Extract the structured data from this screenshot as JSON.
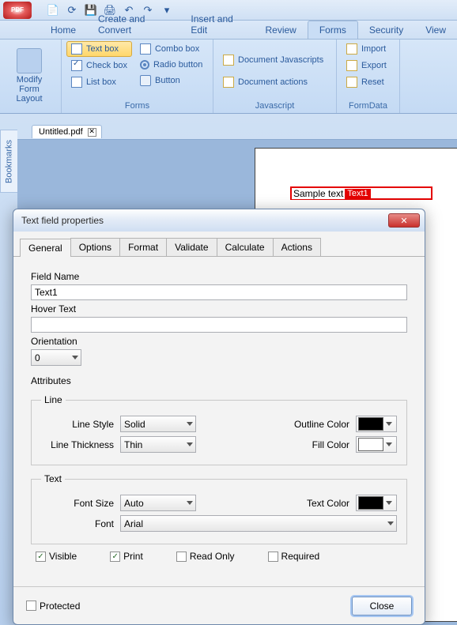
{
  "app": {
    "orb": "PDF"
  },
  "qat": {
    "tips": [
      "pdf-doc",
      "refresh",
      "save",
      "print",
      "undo",
      "redo",
      "more"
    ]
  },
  "tabs": [
    "Home",
    "Create and Convert",
    "Insert and Edit",
    "Review",
    "Forms",
    "Security",
    "View"
  ],
  "active_tab": 4,
  "ribbon": {
    "group1": {
      "title": "",
      "modify": "Modify Form Layout"
    },
    "group2": {
      "title": "Forms",
      "col1": [
        "Text box",
        "Check box",
        "List box"
      ],
      "col2": [
        "Combo box",
        "Radio button",
        "Button"
      ]
    },
    "group3": {
      "title": "Javascript",
      "items": [
        "Document Javascripts",
        "Document actions"
      ]
    },
    "group4": {
      "title": "FormData",
      "items": [
        "Import",
        "Export",
        "Reset"
      ]
    }
  },
  "sidetab": "Bookmarks",
  "filetab": {
    "name": "Untitled.pdf"
  },
  "canvas": {
    "sample_text": "Sample text",
    "field_tag": "Text1"
  },
  "dialog": {
    "title": "Text field properties",
    "tabs": [
      "General",
      "Options",
      "Format",
      "Validate",
      "Calculate",
      "Actions"
    ],
    "active_tab": 0,
    "general": {
      "field_name_label": "Field Name",
      "field_name": "Text1",
      "hover_text_label": "Hover Text",
      "hover_text": "",
      "orientation_label": "Orientation",
      "orientation": "0",
      "attributes_label": "Attributes",
      "line": {
        "legend": "Line",
        "style_label": "Line Style",
        "style": "Solid",
        "thickness_label": "Line Thickness",
        "thickness": "Thin",
        "outline_label": "Outline Color",
        "outline_color": "#000000",
        "fill_label": "Fill Color",
        "fill_color": "#FFFFFF"
      },
      "text": {
        "legend": "Text",
        "size_label": "Font Size",
        "size": "Auto",
        "font_label": "Font",
        "font": "Arial",
        "color_label": "Text Color",
        "text_color": "#000000"
      },
      "checks": {
        "visible": "Visible",
        "visible_on": true,
        "print": "Print",
        "print_on": true,
        "readonly": "Read Only",
        "readonly_on": false,
        "required": "Required",
        "required_on": false
      }
    },
    "footer": {
      "protected": "Protected",
      "protected_on": false,
      "close": "Close"
    }
  }
}
